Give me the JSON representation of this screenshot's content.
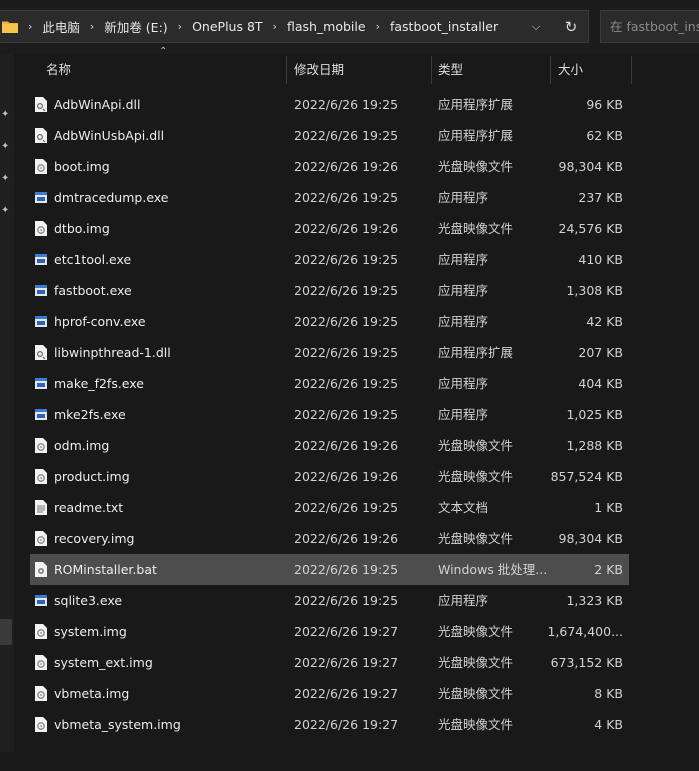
{
  "address_bar": {
    "breadcrumbs": [
      "此电脑",
      "新加卷 (E:)",
      "OnePlus 8T",
      "flash_mobile",
      "fastboot_installer"
    ],
    "separator": "›"
  },
  "search": {
    "placeholder": "在 fastboot_installer 中搜索"
  },
  "columns": {
    "name": "名称",
    "date": "修改日期",
    "type": "类型",
    "size": "大小"
  },
  "files": [
    {
      "name": "AdbWinApi.dll",
      "date": "2022/6/26 19:25",
      "type": "应用程序扩展",
      "size": "96 KB",
      "icon": "dll-icon"
    },
    {
      "name": "AdbWinUsbApi.dll",
      "date": "2022/6/26 19:25",
      "type": "应用程序扩展",
      "size": "62 KB",
      "icon": "dll-icon"
    },
    {
      "name": "boot.img",
      "date": "2022/6/26 19:26",
      "type": "光盘映像文件",
      "size": "98,304 KB",
      "icon": "img-icon"
    },
    {
      "name": "dmtracedump.exe",
      "date": "2022/6/26 19:25",
      "type": "应用程序",
      "size": "237 KB",
      "icon": "exe-icon"
    },
    {
      "name": "dtbo.img",
      "date": "2022/6/26 19:26",
      "type": "光盘映像文件",
      "size": "24,576 KB",
      "icon": "img-icon"
    },
    {
      "name": "etc1tool.exe",
      "date": "2022/6/26 19:25",
      "type": "应用程序",
      "size": "410 KB",
      "icon": "exe-icon"
    },
    {
      "name": "fastboot.exe",
      "date": "2022/6/26 19:25",
      "type": "应用程序",
      "size": "1,308 KB",
      "icon": "exe-icon"
    },
    {
      "name": "hprof-conv.exe",
      "date": "2022/6/26 19:25",
      "type": "应用程序",
      "size": "42 KB",
      "icon": "exe-icon"
    },
    {
      "name": "libwinpthread-1.dll",
      "date": "2022/6/26 19:25",
      "type": "应用程序扩展",
      "size": "207 KB",
      "icon": "dll-icon"
    },
    {
      "name": "make_f2fs.exe",
      "date": "2022/6/26 19:25",
      "type": "应用程序",
      "size": "404 KB",
      "icon": "exe-icon"
    },
    {
      "name": "mke2fs.exe",
      "date": "2022/6/26 19:25",
      "type": "应用程序",
      "size": "1,025 KB",
      "icon": "exe-icon"
    },
    {
      "name": "odm.img",
      "date": "2022/6/26 19:26",
      "type": "光盘映像文件",
      "size": "1,288 KB",
      "icon": "img-icon"
    },
    {
      "name": "product.img",
      "date": "2022/6/26 19:26",
      "type": "光盘映像文件",
      "size": "857,524 KB",
      "icon": "img-icon"
    },
    {
      "name": "readme.txt",
      "date": "2022/6/26 19:25",
      "type": "文本文档",
      "size": "1 KB",
      "icon": "txt-icon"
    },
    {
      "name": "recovery.img",
      "date": "2022/6/26 19:26",
      "type": "光盘映像文件",
      "size": "98,304 KB",
      "icon": "img-icon"
    },
    {
      "name": "ROMinstaller.bat",
      "date": "2022/6/26 19:25",
      "type": "Windows 批处理...",
      "size": "2 KB",
      "icon": "bat-icon",
      "selected": true
    },
    {
      "name": "sqlite3.exe",
      "date": "2022/6/26 19:25",
      "type": "应用程序",
      "size": "1,323 KB",
      "icon": "exe-icon"
    },
    {
      "name": "system.img",
      "date": "2022/6/26 19:27",
      "type": "光盘映像文件",
      "size": "1,674,400...",
      "icon": "img-icon"
    },
    {
      "name": "system_ext.img",
      "date": "2022/6/26 19:27",
      "type": "光盘映像文件",
      "size": "673,152 KB",
      "icon": "img-icon"
    },
    {
      "name": "vbmeta.img",
      "date": "2022/6/26 19:27",
      "type": "光盘映像文件",
      "size": "8 KB",
      "icon": "img-icon"
    },
    {
      "name": "vbmeta_system.img",
      "date": "2022/6/26 19:27",
      "type": "光盘映像文件",
      "size": "4 KB",
      "icon": "img-icon"
    }
  ]
}
